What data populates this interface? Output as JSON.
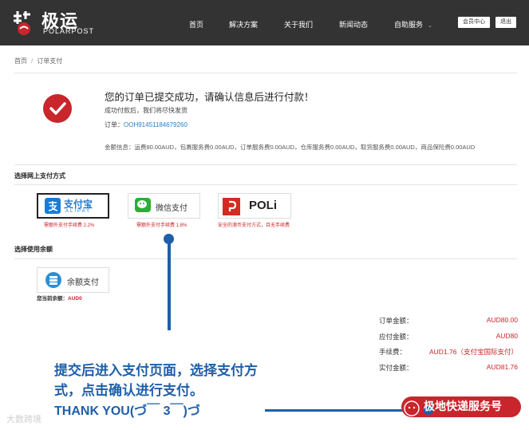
{
  "brand": {
    "name_cn": "极运",
    "name_en": "POLARPOST"
  },
  "nav": {
    "items": [
      "首页",
      "解决方案",
      "关于我们",
      "新闻动态",
      "自助服务"
    ],
    "member_button": "会员中心",
    "logout_button": "退出"
  },
  "breadcrumb": {
    "home": "首页",
    "sep": "/",
    "current": "订单支付"
  },
  "success": {
    "title": "您的订单已提交成功，请确认信息后进行付款！",
    "subtitle": "成功付款后，我们将尽快发货",
    "order_label": "订单：",
    "order_number": "OOH91451184679260",
    "fees": "金额信息：运费80.00AUD，包裹服务费0.00AUD，订单服务费0.00AUD，仓库服务费0.00AUD，取货服务费0.00AUD，商品保险费0.00AUD"
  },
  "online_payment": {
    "title": "选择网上支付方式",
    "options": [
      {
        "name": "支付宝",
        "sub": "ALIPAY",
        "note": "需额外支付手续费 2.2%",
        "selected": true
      },
      {
        "name": "微信支付",
        "note": "需额外支付手续费 1.8%",
        "selected": false
      },
      {
        "name": "POLi",
        "note": "安全的澳币支付方式，且无手续费",
        "selected": false
      }
    ]
  },
  "balance_payment": {
    "title": "选择使用余额",
    "option_name": "余额支付",
    "balance_label": "您当前余额：",
    "balance_value": "AUD0"
  },
  "summary": [
    {
      "label": "订单金额：",
      "value": "AUD80.00"
    },
    {
      "label": "应付金额：",
      "value": "AUD80"
    },
    {
      "label": "手续费：",
      "value": "AUD1.76（支付宝国际支付）"
    },
    {
      "label": "实付金额：",
      "value": "AUD81.76"
    }
  ],
  "annotation": {
    "text": "提交后进入支付页面，选择支付方式，点击确认进行支付。",
    "thanks": "THANK YOU(づ￣ 3￣)づ"
  },
  "watermarks": {
    "left": "大数跨境",
    "right": "极地快递服务号"
  },
  "colors": {
    "nav_bg": "#333333",
    "accent_red": "#c9252c",
    "annotation_blue": "#1f5fa8",
    "link_blue": "#2a7fc8"
  }
}
